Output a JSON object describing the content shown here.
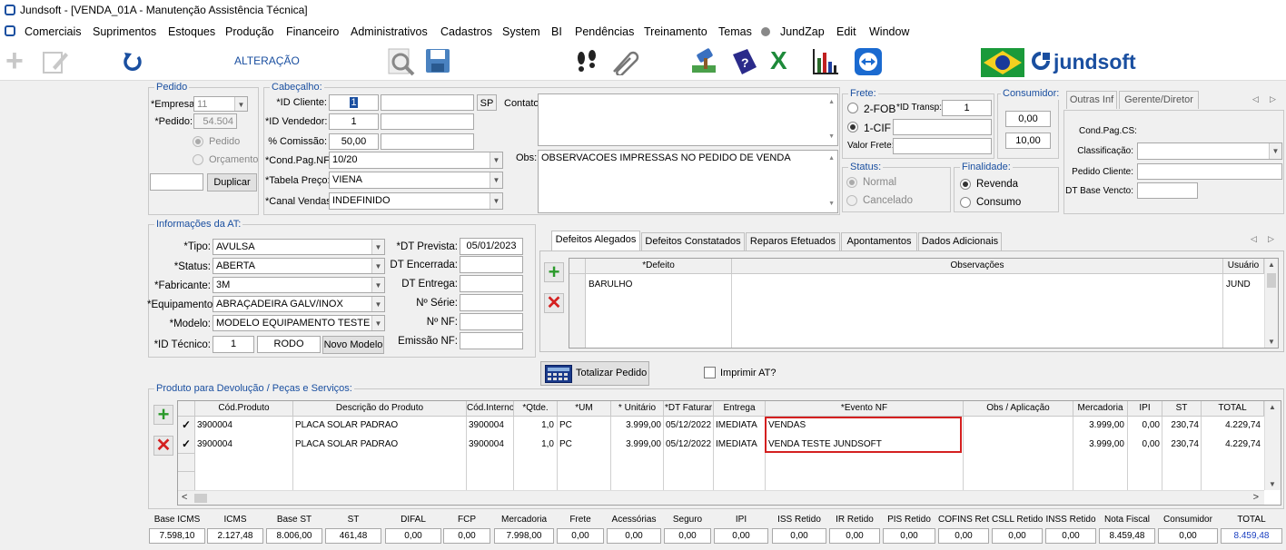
{
  "window": {
    "title": "Jundsoft - [VENDA_01A - Manutenção Assistência Técnica]"
  },
  "menu": [
    "Comerciais",
    "Suprimentos",
    "Estoques",
    "Produção",
    "Financeiro",
    "Administrativos",
    "Cadastros",
    "System",
    "BI",
    "Pendências",
    "Treinamento",
    "Temas",
    "JundZap",
    "Edit",
    "Window"
  ],
  "toolbar": {
    "mode": "ALTERAÇÃO",
    "brand": "jundsoft"
  },
  "pedido": {
    "group": "Pedido",
    "empresa_label": "*Empresa:",
    "empresa": "11",
    "pedido_label": "*Pedido:",
    "pedido": "54.504",
    "opt_pedido": "Pedido",
    "opt_orcamento": "Orçamento",
    "duplicar": "Duplicar"
  },
  "cabecalho": {
    "group": "Cabeçalho:",
    "id_cliente_label": "*ID Cliente:",
    "id_cliente": "1",
    "uf": "SP",
    "contato_label": "Contato:",
    "id_vendedor_label": "*ID Vendedor:",
    "id_vendedor": "1",
    "comissao_label": "% Comissão:",
    "comissao": "50,00",
    "cond_label": "*Cond.Pag.NF:",
    "cond": "10/20",
    "tabela_label": "*Tabela Preço:",
    "tabela": "VIENA",
    "canal_label": "*Canal Vendas:",
    "canal": "INDEFINIDO",
    "obs_label": "Obs:",
    "obs": "OBSERVACOES IMPRESSAS NO PEDIDO DE VENDA"
  },
  "frete": {
    "group": "Frete:",
    "fob": "2-FOB",
    "cif": "1-CIF",
    "id_transp_label": "*ID Transp:",
    "id_transp": "1",
    "valor_label": "Valor Frete:"
  },
  "consumidor": {
    "group": "Consumidor:",
    "v1": "0,00",
    "v2": "10,00"
  },
  "status": {
    "group": "Status:",
    "normal": "Normal",
    "cancelado": "Cancelado"
  },
  "finalidade": {
    "group": "Finalidade:",
    "revenda": "Revenda",
    "consumo": "Consumo"
  },
  "right_panel": {
    "tabs": [
      "Outras Inf",
      "Gerente/Diretor"
    ],
    "cond_cs": "Cond.Pag.CS:",
    "classificacao": "Classificação:",
    "pedido_cliente": "Pedido Cliente:",
    "dt_base": "DT Base Vencto:"
  },
  "at": {
    "group": "Informações da AT:",
    "tipo_label": "*Tipo:",
    "tipo": "AVULSA",
    "status_label": "*Status:",
    "status": "ABERTA",
    "fabricante_label": "*Fabricante:",
    "fabricante": "3M",
    "equip_label": "*Equipamento:",
    "equip": "ABRAÇADEIRA GALV/INOX",
    "modelo_label": "*Modelo:",
    "modelo": "MODELO EQUIPAMENTO TESTE",
    "tecnico_label": "*ID Técnico:",
    "tecnico": "1",
    "tecnico_nome": "RODO",
    "novo_modelo": "Novo Modelo",
    "dt_prevista_label": "*DT Prevista:",
    "dt_prevista": "05/01/2023",
    "dt_encerrada_label": "DT Encerrada:",
    "dt_entrega_label": "DT Entrega:",
    "serie_label": "Nº Série:",
    "nf_label": "Nº NF:",
    "emissao_label": "Emissão NF:"
  },
  "defeitos": {
    "tabs": [
      "Defeitos Alegados",
      "Defeitos Constatados",
      "Reparos Efetuados",
      "Apontamentos",
      "Dados Adicionais"
    ],
    "columns": [
      "*Defeito",
      "Observações",
      "Usuário"
    ],
    "rows": [
      {
        "defeito": "BARULHO",
        "obs": "",
        "usuario": "JUND"
      }
    ]
  },
  "totalizar": {
    "button": "Totalizar Pedido",
    "imprimir": "Imprimir AT?"
  },
  "produtos": {
    "group": "Produto para Devolução / Peças e Serviços:",
    "columns": [
      "Cód.Produto",
      "Descrição do Produto",
      "Cód.Interno",
      "*Qtde.",
      "*UM",
      "* Unitário",
      "*DT Faturar",
      "Entrega",
      "*Evento NF",
      "Obs / Aplicação",
      "Mercadoria",
      "IPI",
      "ST",
      "TOTAL"
    ],
    "rows": [
      {
        "cod": "3900004",
        "desc": "PLACA SOLAR PADRAO",
        "interno": "3900004",
        "qtde": "1,0",
        "um": "PC",
        "unit": "3.999,00",
        "dt": "05/12/2022",
        "entrega": "IMEDIATA",
        "evento": "VENDAS",
        "obs": "",
        "merc": "3.999,00",
        "ipi": "0,00",
        "st": "230,74",
        "total": "4.229,74"
      },
      {
        "cod": "3900004",
        "desc": "PLACA SOLAR PADRAO",
        "interno": "3900004",
        "qtde": "1,0",
        "um": "PC",
        "unit": "3.999,00",
        "dt": "05/12/2022",
        "entrega": "IMEDIATA",
        "evento": "VENDA TESTE JUNDSOFT",
        "obs": "",
        "merc": "3.999,00",
        "ipi": "0,00",
        "st": "230,74",
        "total": "4.229,74"
      }
    ]
  },
  "totais": {
    "labels": [
      "Base ICMS",
      "ICMS",
      "Base ST",
      "ST",
      "DIFAL",
      "FCP",
      "Mercadoria",
      "Frete",
      "Acessórias",
      "Seguro",
      "IPI",
      "ISS Retido",
      "IR Retido",
      "PIS Retido",
      "COFINS Ret",
      "CSLL Retido",
      "INSS Retido",
      "Nota Fiscal",
      "Consumidor",
      "TOTAL"
    ],
    "values": [
      "7.598,10",
      "2.127,48",
      "8.006,00",
      "461,48",
      "0,00",
      "0,00",
      "7.998,00",
      "0,00",
      "0,00",
      "0,00",
      "0,00",
      "0,00",
      "0,00",
      "0,00",
      "0,00",
      "0,00",
      "0,00",
      "8.459,48",
      "0,00",
      "8.459,48"
    ]
  },
  "colors": {
    "accent": "#1a4fa0",
    "highlight": "#d42020",
    "total": "#1a3fc0"
  }
}
